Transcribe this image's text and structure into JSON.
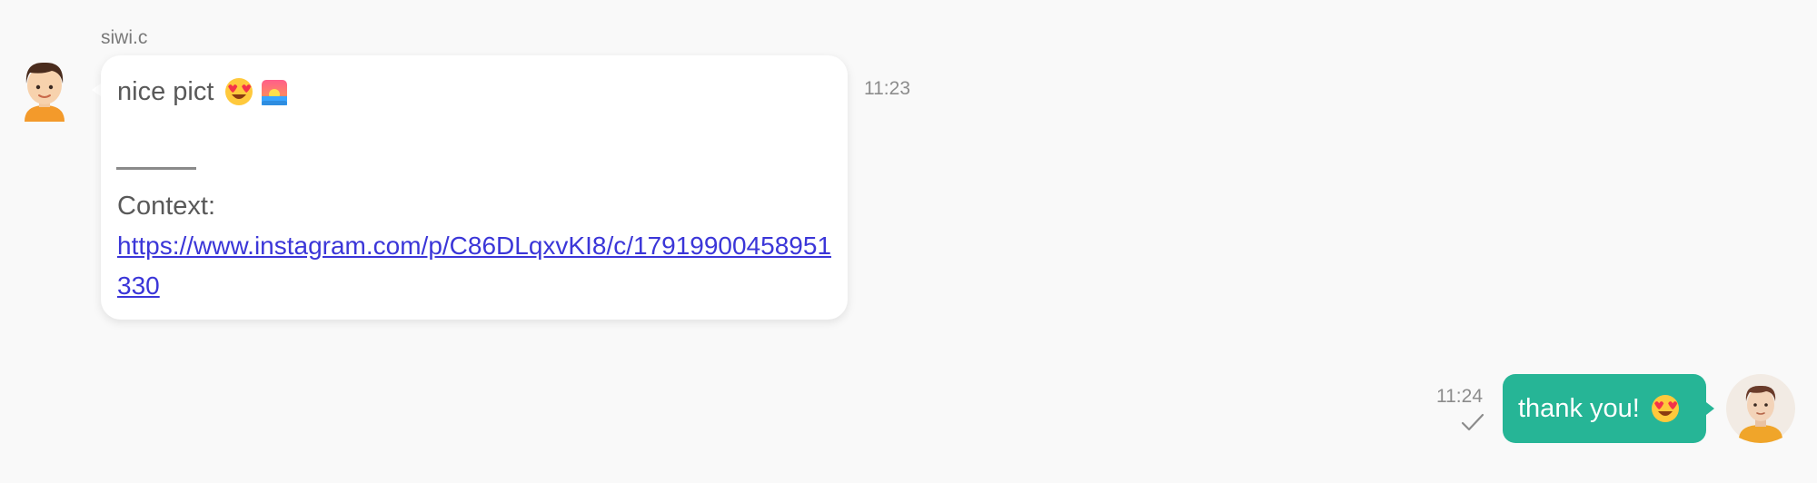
{
  "incoming_message": {
    "sender": "siwi.c",
    "text": "nice pict",
    "emojis": [
      "heart-eyes-emoji",
      "sunrise-emoji"
    ],
    "divider": "———",
    "context_label": "Context:",
    "context_link": "https://www.instagram.com/p/C86DLqxvKI8/c/17919900458951330",
    "time": "11:23"
  },
  "outgoing_message": {
    "text": "thank you!",
    "emojis": [
      "heart-eyes-emoji"
    ],
    "time": "11:24",
    "status_icon": "check-icon"
  },
  "colors": {
    "background": "#f9f9f9",
    "incoming_bubble": "#ffffff",
    "outgoing_bubble": "#26b596",
    "link": "#3b36d8",
    "muted_text": "#8c8c8c"
  }
}
